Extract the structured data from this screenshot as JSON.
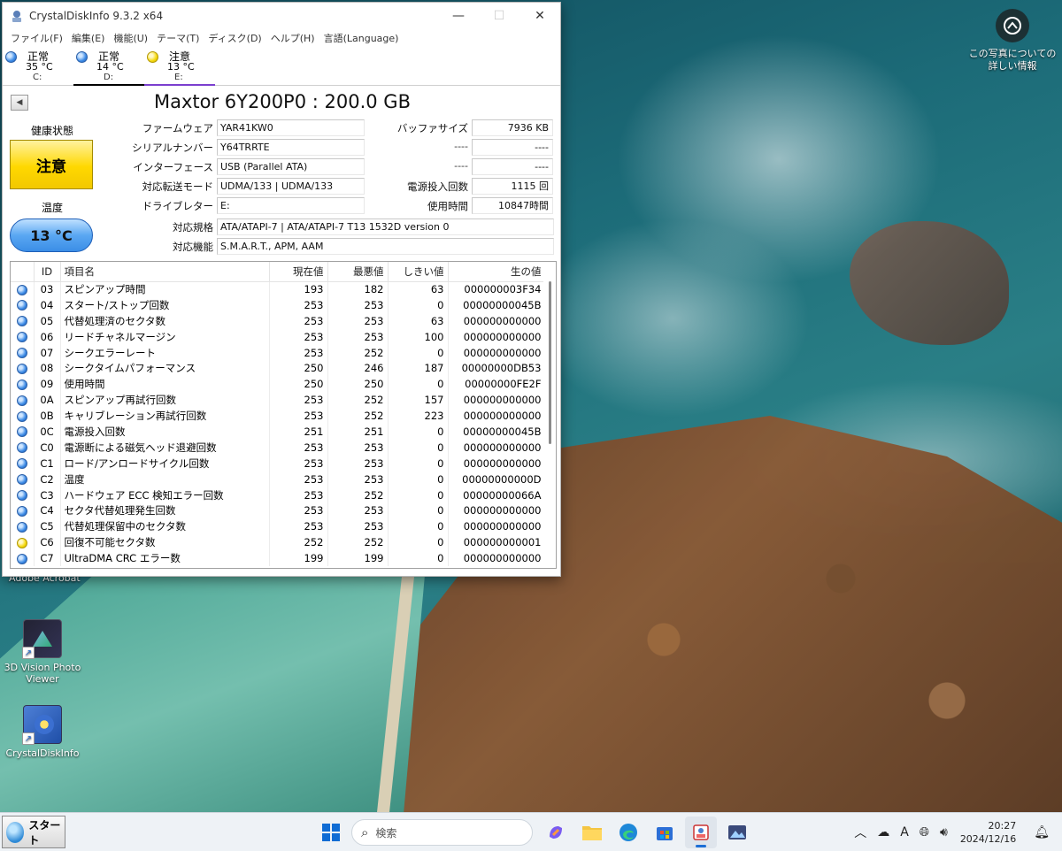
{
  "window": {
    "title": "CrystalDiskInfo 9.3.2 x64",
    "menu": [
      "ファイル(F)",
      "編集(E)",
      "機能(U)",
      "テーマ(T)",
      "ディスク(D)",
      "ヘルプ(H)",
      "言語(Language)"
    ],
    "drives": [
      {
        "status": "正常",
        "temp": "35 °C",
        "letter": "C:",
        "color": "blue"
      },
      {
        "status": "正常",
        "temp": "14 °C",
        "letter": "D:",
        "color": "blue"
      },
      {
        "status": "注意",
        "temp": "13 °C",
        "letter": "E:",
        "color": "yellow"
      }
    ]
  },
  "disk": {
    "model": "Maxtor 6Y200P0 : 200.0 GB",
    "health_label": "健康状態",
    "health_status": "注意",
    "temp_label": "温度",
    "temperature": "13 °C",
    "labels": {
      "firmware": "ファームウェア",
      "serial": "シリアルナンバー",
      "interface": "インターフェース",
      "transfer": "対応転送モード",
      "drive_letter": "ドライブレター",
      "standard": "対応規格",
      "features": "対応機能",
      "buffer": "バッファサイズ",
      "power_count": "電源投入回数",
      "power_hours": "使用時間"
    },
    "values": {
      "firmware": "YAR41KW0",
      "serial": "Y64TRRTE",
      "interface": "USB (Parallel ATA)",
      "transfer": "UDMA/133 | UDMA/133",
      "drive_letter": "E:",
      "standard": "ATA/ATAPI-7 | ATA/ATAPI-7 T13 1532D version 0",
      "features": "S.M.A.R.T., APM, AAM",
      "buffer": "7936 KB",
      "blank_label": "----",
      "blank_value": "----",
      "power_count": "1115 回",
      "power_hours": "10847時間"
    }
  },
  "smart": {
    "headers": [
      "ID",
      "項目名",
      "現在値",
      "最悪値",
      "しきい値",
      "生の値"
    ],
    "rows": [
      {
        "color": "blue",
        "id": "03",
        "name": "スピンアップ時間",
        "cur": "193",
        "worst": "182",
        "thr": "63",
        "raw": "000000003F34"
      },
      {
        "color": "blue",
        "id": "04",
        "name": "スタート/ストップ回数",
        "cur": "253",
        "worst": "253",
        "thr": "0",
        "raw": "00000000045B"
      },
      {
        "color": "blue",
        "id": "05",
        "name": "代替処理済のセクタ数",
        "cur": "253",
        "worst": "253",
        "thr": "63",
        "raw": "000000000000"
      },
      {
        "color": "blue",
        "id": "06",
        "name": "リードチャネルマージン",
        "cur": "253",
        "worst": "253",
        "thr": "100",
        "raw": "000000000000"
      },
      {
        "color": "blue",
        "id": "07",
        "name": "シークエラーレート",
        "cur": "253",
        "worst": "252",
        "thr": "0",
        "raw": "000000000000"
      },
      {
        "color": "blue",
        "id": "08",
        "name": "シークタイムパフォーマンス",
        "cur": "250",
        "worst": "246",
        "thr": "187",
        "raw": "00000000DB53"
      },
      {
        "color": "blue",
        "id": "09",
        "name": "使用時間",
        "cur": "250",
        "worst": "250",
        "thr": "0",
        "raw": "00000000FE2F"
      },
      {
        "color": "blue",
        "id": "0A",
        "name": "スピンアップ再試行回数",
        "cur": "253",
        "worst": "252",
        "thr": "157",
        "raw": "000000000000"
      },
      {
        "color": "blue",
        "id": "0B",
        "name": "キャリブレーション再試行回数",
        "cur": "253",
        "worst": "252",
        "thr": "223",
        "raw": "000000000000"
      },
      {
        "color": "blue",
        "id": "0C",
        "name": "電源投入回数",
        "cur": "251",
        "worst": "251",
        "thr": "0",
        "raw": "00000000045B"
      },
      {
        "color": "blue",
        "id": "C0",
        "name": "電源断による磁気ヘッド退避回数",
        "cur": "253",
        "worst": "253",
        "thr": "0",
        "raw": "000000000000"
      },
      {
        "color": "blue",
        "id": "C1",
        "name": "ロード/アンロードサイクル回数",
        "cur": "253",
        "worst": "253",
        "thr": "0",
        "raw": "000000000000"
      },
      {
        "color": "blue",
        "id": "C2",
        "name": "温度",
        "cur": "253",
        "worst": "253",
        "thr": "0",
        "raw": "00000000000D"
      },
      {
        "color": "blue",
        "id": "C3",
        "name": "ハードウェア ECC 検知エラー回数",
        "cur": "253",
        "worst": "252",
        "thr": "0",
        "raw": "00000000066A"
      },
      {
        "color": "blue",
        "id": "C4",
        "name": "セクタ代替処理発生回数",
        "cur": "253",
        "worst": "253",
        "thr": "0",
        "raw": "000000000000"
      },
      {
        "color": "blue",
        "id": "C5",
        "name": "代替処理保留中のセクタ数",
        "cur": "253",
        "worst": "253",
        "thr": "0",
        "raw": "000000000000"
      },
      {
        "color": "yellow",
        "id": "C6",
        "name": "回復不可能セクタ数",
        "cur": "252",
        "worst": "252",
        "thr": "0",
        "raw": "000000000001"
      },
      {
        "color": "blue",
        "id": "C7",
        "name": "UltraDMA CRC エラー数",
        "cur": "199",
        "worst": "199",
        "thr": "0",
        "raw": "000000000000"
      }
    ]
  },
  "desktop": {
    "photo_info": "この写真についての詳しい情報",
    "icons": [
      {
        "label": "Adobe Acrobat"
      },
      {
        "label": "3D Vision Photo Viewer"
      },
      {
        "label": "CrystalDiskInfo"
      }
    ]
  },
  "taskbar": {
    "start_label": "スタート",
    "search_placeholder": "検索",
    "ime": "A",
    "time": "20:27",
    "date": "2024/12/16"
  },
  "colors": {
    "status_blue": "#3d8be6",
    "status_yellow": "#f5d90e",
    "accent": "#1d6fd6"
  }
}
